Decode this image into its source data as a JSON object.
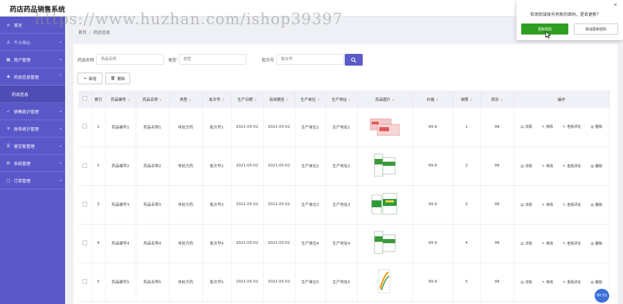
{
  "app": {
    "title": "药店药品销售系统"
  },
  "watermark": "https://www.huzhan.com/ishop39397",
  "sidebar": {
    "items": [
      {
        "label": "首页",
        "icon": "home-icon"
      },
      {
        "label": "个人中心",
        "icon": "user-icon"
      },
      {
        "label": "用户管理",
        "icon": "grid-icon"
      },
      {
        "label": "药品信息管理",
        "icon": "pill-icon"
      },
      {
        "label": "销售统计管理",
        "icon": "chart-icon"
      },
      {
        "label": "财务统计管理",
        "icon": "money-icon"
      },
      {
        "label": "留言板管理",
        "icon": "message-icon"
      },
      {
        "label": "系统管理",
        "icon": "settings-icon"
      },
      {
        "label": "订单管理",
        "icon": "order-icon"
      }
    ],
    "subitem": "药品信息"
  },
  "breadcrumb": {
    "home": "首页",
    "sep": "/",
    "current": "药品信息"
  },
  "search": {
    "name_label": "药品名称",
    "name_placeholder": "药品名称",
    "type_label": "类型",
    "type_placeholder": "类型",
    "batch_label": "批次号",
    "batch_placeholder": "批次号"
  },
  "toolbar": {
    "add": "新增",
    "delete": "删除"
  },
  "table": {
    "headers": [
      "索引",
      "药品编号",
      "药品名称",
      "类型",
      "批次号",
      "生产日期",
      "有效期至",
      "生产单位",
      "生产地址",
      "药品图片",
      "价格",
      "单限",
      "库存",
      "操作"
    ],
    "rows": [
      {
        "index": "1",
        "code": "药品编号1",
        "name": "药品名称1",
        "type": "非处方药",
        "batch": "批次号1",
        "prod": "2021-05-02",
        "exp": "2021-05-02",
        "unit": "生产单位1",
        "addr": "生产地址1",
        "price": "99.9",
        "limit": "1",
        "stock": "99"
      },
      {
        "index": "2",
        "code": "药品编号2",
        "name": "药品名称2",
        "type": "非处方药",
        "batch": "批次号2",
        "prod": "2021-05-02",
        "exp": "2021-05-02",
        "unit": "生产单位2",
        "addr": "生产地址2",
        "price": "99.9",
        "limit": "2",
        "stock": "99"
      },
      {
        "index": "3",
        "code": "药品编号3",
        "name": "药品名称3",
        "type": "非处方药",
        "batch": "批次号3",
        "prod": "2021-05-02",
        "exp": "2021-05-02",
        "unit": "生产单位3",
        "addr": "生产地址3",
        "price": "99.9",
        "limit": "3",
        "stock": "99"
      },
      {
        "index": "4",
        "code": "药品编号4",
        "name": "药品名称4",
        "type": "非处方药",
        "batch": "批次号4",
        "prod": "2021-05-02",
        "exp": "2021-05-02",
        "unit": "生产单位4",
        "addr": "生产地址4",
        "price": "99.9",
        "limit": "4",
        "stock": "99"
      },
      {
        "index": "5",
        "code": "药品编号5",
        "name": "药品名称5",
        "type": "非处方药",
        "batch": "批次号5",
        "prod": "2021-05-02",
        "exp": "2021-05-02",
        "unit": "生产单位5",
        "addr": "生产地址5",
        "price": "99.9",
        "limit": "5",
        "stock": "99"
      }
    ],
    "actions": {
      "detail": "详情",
      "edit": "修改",
      "review": "查看评论",
      "delete": "删除"
    }
  },
  "dialog": {
    "message": "检测到该账号有新的密码，是否更新？",
    "ok": "更新密码",
    "cancel": "取消更新密码",
    "close": "×"
  },
  "float_badge": "00:51",
  "colors": {
    "sidebar": "#5a58c9",
    "accent": "#5b5ac8",
    "ok": "#2e9e20"
  }
}
